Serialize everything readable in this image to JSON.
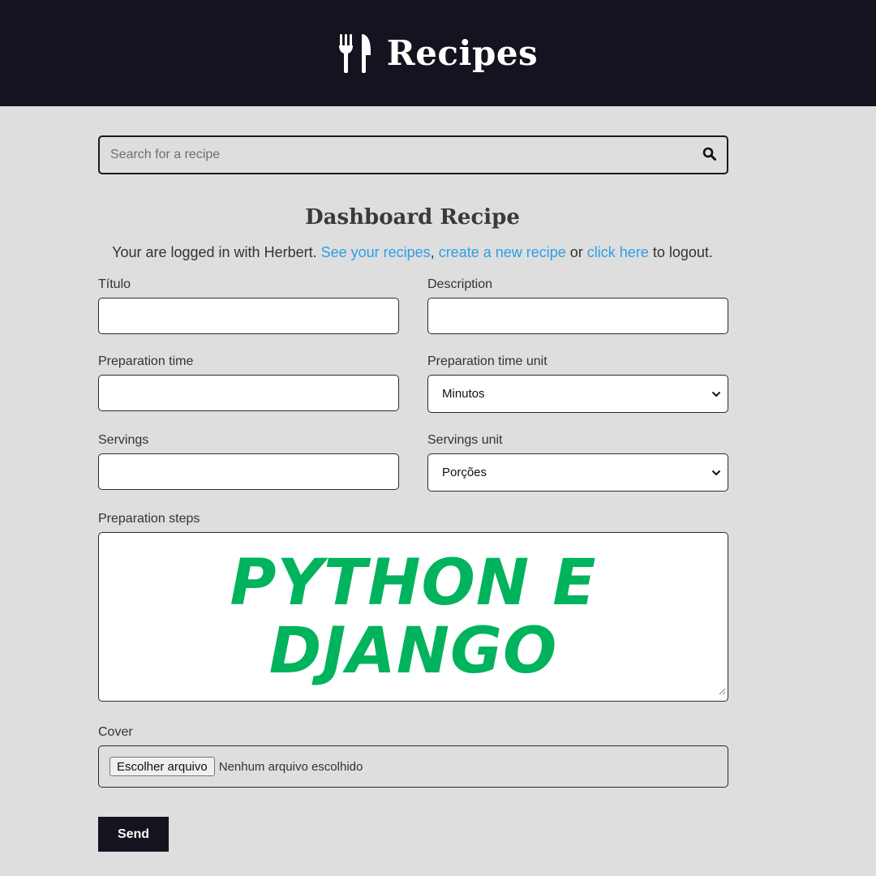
{
  "header": {
    "title": "Recipes",
    "icon": "utensils-icon",
    "background": "#141420"
  },
  "search": {
    "placeholder": "Search for a recipe",
    "icon": "search-icon"
  },
  "page": {
    "title": "Dashboard Recipe",
    "intro_prefix": "Your are logged in with Herbert. ",
    "link_recipes": "See your recipes",
    "sep1": ", ",
    "link_create": "create a new recipe",
    "sep2": " or ",
    "link_logout": "click here",
    "intro_suffix": " to logout.",
    "link_color": "#2d9ee8"
  },
  "form": {
    "titulo_label": "Título",
    "description_label": "Description",
    "prep_time_label": "Preparation time",
    "prep_time_unit_label": "Preparation time unit",
    "prep_time_unit_value": "Minutos",
    "servings_label": "Servings",
    "servings_unit_label": "Servings unit",
    "servings_unit_value": "Porções",
    "steps_label": "Preparation steps",
    "cover_label": "Cover",
    "file_button": "Escolher arquivo",
    "file_status": "Nenhum arquivo escolhido",
    "send_label": "Send"
  },
  "overlay": {
    "line1": "PYTHON E",
    "line2": "DJANGO",
    "color": "#00b35c"
  }
}
